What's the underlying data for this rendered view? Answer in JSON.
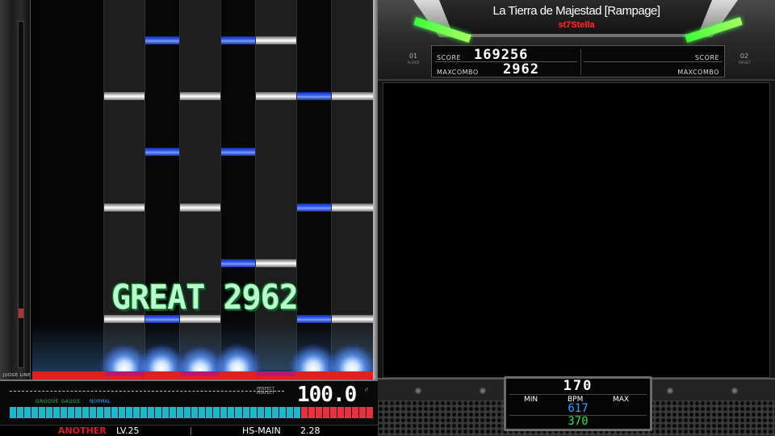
{
  "playfield": {
    "judge_line_label": "JUDGE LINE",
    "judgement": "GREAT",
    "combo": "2962",
    "notes": [
      {
        "lane": 2,
        "color": "blue",
        "row": 0
      },
      {
        "lane": 4,
        "color": "blue",
        "row": 0
      },
      {
        "lane": 5,
        "color": "white",
        "row": 0
      },
      {
        "lane": 1,
        "color": "white",
        "row": 1
      },
      {
        "lane": 3,
        "color": "white",
        "row": 1
      },
      {
        "lane": 5,
        "color": "white",
        "row": 1
      },
      {
        "lane": 6,
        "color": "blue",
        "row": 1
      },
      {
        "lane": 7,
        "color": "white",
        "row": 1
      },
      {
        "lane": 2,
        "color": "blue",
        "row": 2
      },
      {
        "lane": 4,
        "color": "blue",
        "row": 2
      },
      {
        "lane": 1,
        "color": "white",
        "row": 3
      },
      {
        "lane": 3,
        "color": "white",
        "row": 3
      },
      {
        "lane": 6,
        "color": "blue",
        "row": 3
      },
      {
        "lane": 7,
        "color": "white",
        "row": 3
      },
      {
        "lane": 4,
        "color": "blue",
        "row": 4
      },
      {
        "lane": 5,
        "color": "white",
        "row": 4
      },
      {
        "lane": 1,
        "color": "white",
        "row": 5
      },
      {
        "lane": 2,
        "color": "blue",
        "row": 5
      },
      {
        "lane": 3,
        "color": "white",
        "row": 5
      },
      {
        "lane": 6,
        "color": "blue",
        "row": 5
      },
      {
        "lane": 7,
        "color": "white",
        "row": 5
      }
    ]
  },
  "gauge": {
    "groove_label": "GROOVE GAUGE",
    "mode": "NORMAL",
    "perfect_label_1": "PERFECT",
    "perfect_label_2": "PERFECT",
    "value": "100.0",
    "percent_label": "%",
    "fill": 1.0,
    "segments": 50,
    "clear_segments_start": 40,
    "colors": {
      "normal": "#1ab8c8",
      "clear": "#e83040"
    }
  },
  "info": {
    "difficulty": "ANOTHER",
    "level": "LV.25",
    "hs_label": "HS-MAIN",
    "hs_value": "2.28"
  },
  "header": {
    "song_title": "La Tierra de Majestad [Rampage]",
    "artist": "st7Stella",
    "p1_tag": "01",
    "p1_sub": "PLAYER",
    "p2_tag": "02",
    "p2_sub": "TARGET"
  },
  "score_panel": {
    "score_label": "SCORE",
    "score_value": "169256",
    "maxcombo_label": "MAXCOMBO",
    "maxcombo_value": "2962",
    "target_score_label": "SCORE",
    "target_maxcombo_label": "MAXCOMBO"
  },
  "bpm": {
    "current": "170",
    "min_label": "MIN",
    "bpm_label": "BPM",
    "max_label": "MAX",
    "max_value": "617",
    "min_value": "370",
    "colors": {
      "max": "#39a0ff",
      "min": "#3ddc4a"
    }
  }
}
